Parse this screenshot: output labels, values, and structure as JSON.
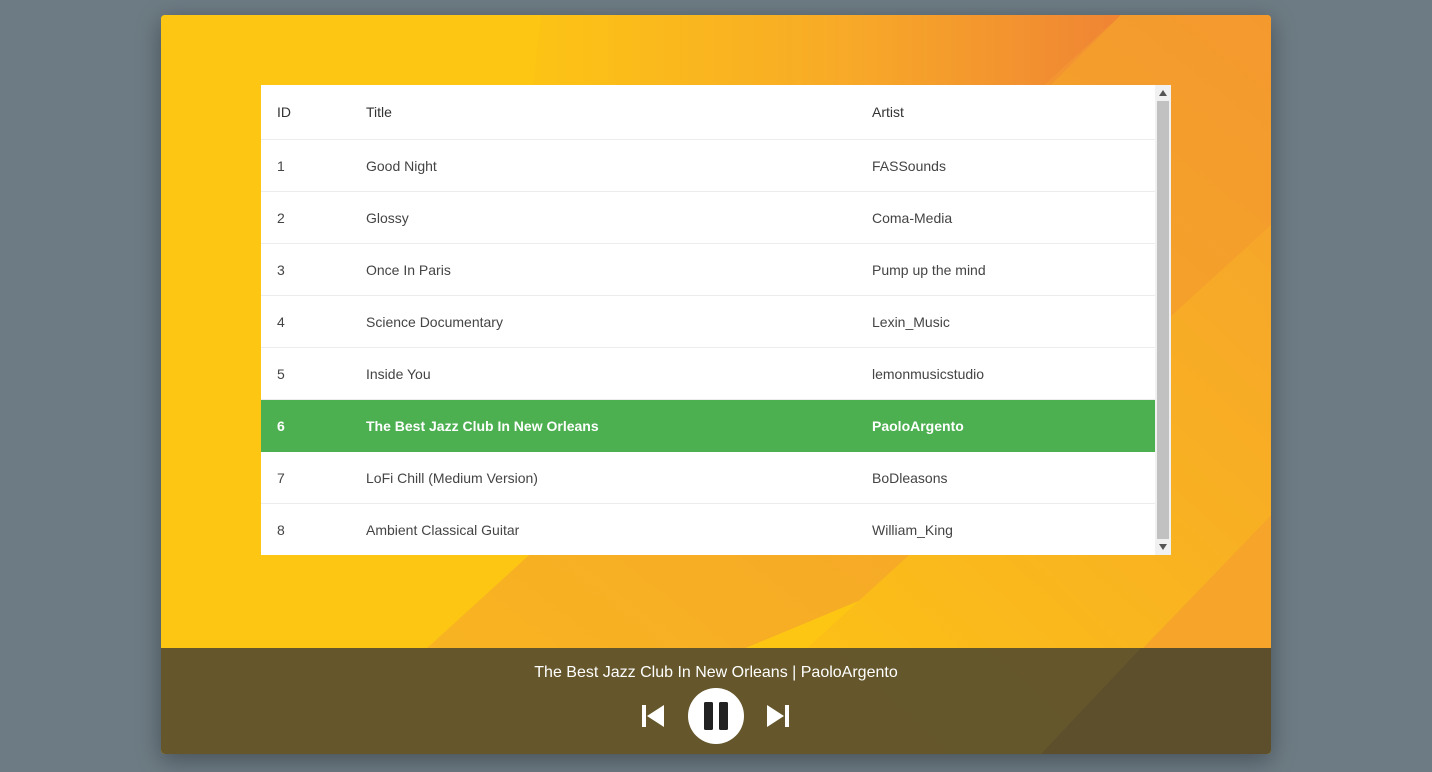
{
  "playlist": {
    "headers": {
      "id": "ID",
      "title": "Title",
      "artist": "Artist"
    },
    "rows": [
      {
        "id": "1",
        "title": "Good Night",
        "artist": "FASSounds"
      },
      {
        "id": "2",
        "title": "Glossy",
        "artist": "Coma-Media"
      },
      {
        "id": "3",
        "title": "Once In Paris",
        "artist": "Pump up the mind"
      },
      {
        "id": "4",
        "title": "Science Documentary",
        "artist": "Lexin_Music"
      },
      {
        "id": "5",
        "title": "Inside You",
        "artist": "lemonmusicstudio"
      },
      {
        "id": "6",
        "title": "The Best Jazz Club In New Orleans",
        "artist": "PaoloArgento"
      },
      {
        "id": "7",
        "title": "LoFi Chill (Medium Version)",
        "artist": "BoDleasons"
      },
      {
        "id": "8",
        "title": "Ambient Classical Guitar",
        "artist": "William_King"
      }
    ],
    "active_row_id": "6"
  },
  "player": {
    "now_playing": "The Best Jazz Club In New Orleans | PaoloArgento",
    "controls": {
      "previous_icon": "skip-previous-icon",
      "play_pause_icon": "pause-icon",
      "next_icon": "skip-next-icon"
    }
  },
  "colors": {
    "page_background": "#6d7b84",
    "card_yellow": "#fdc612",
    "card_orange": "#f08a36",
    "active_row": "#4caf50",
    "bottom_bar": "#5f522d"
  }
}
